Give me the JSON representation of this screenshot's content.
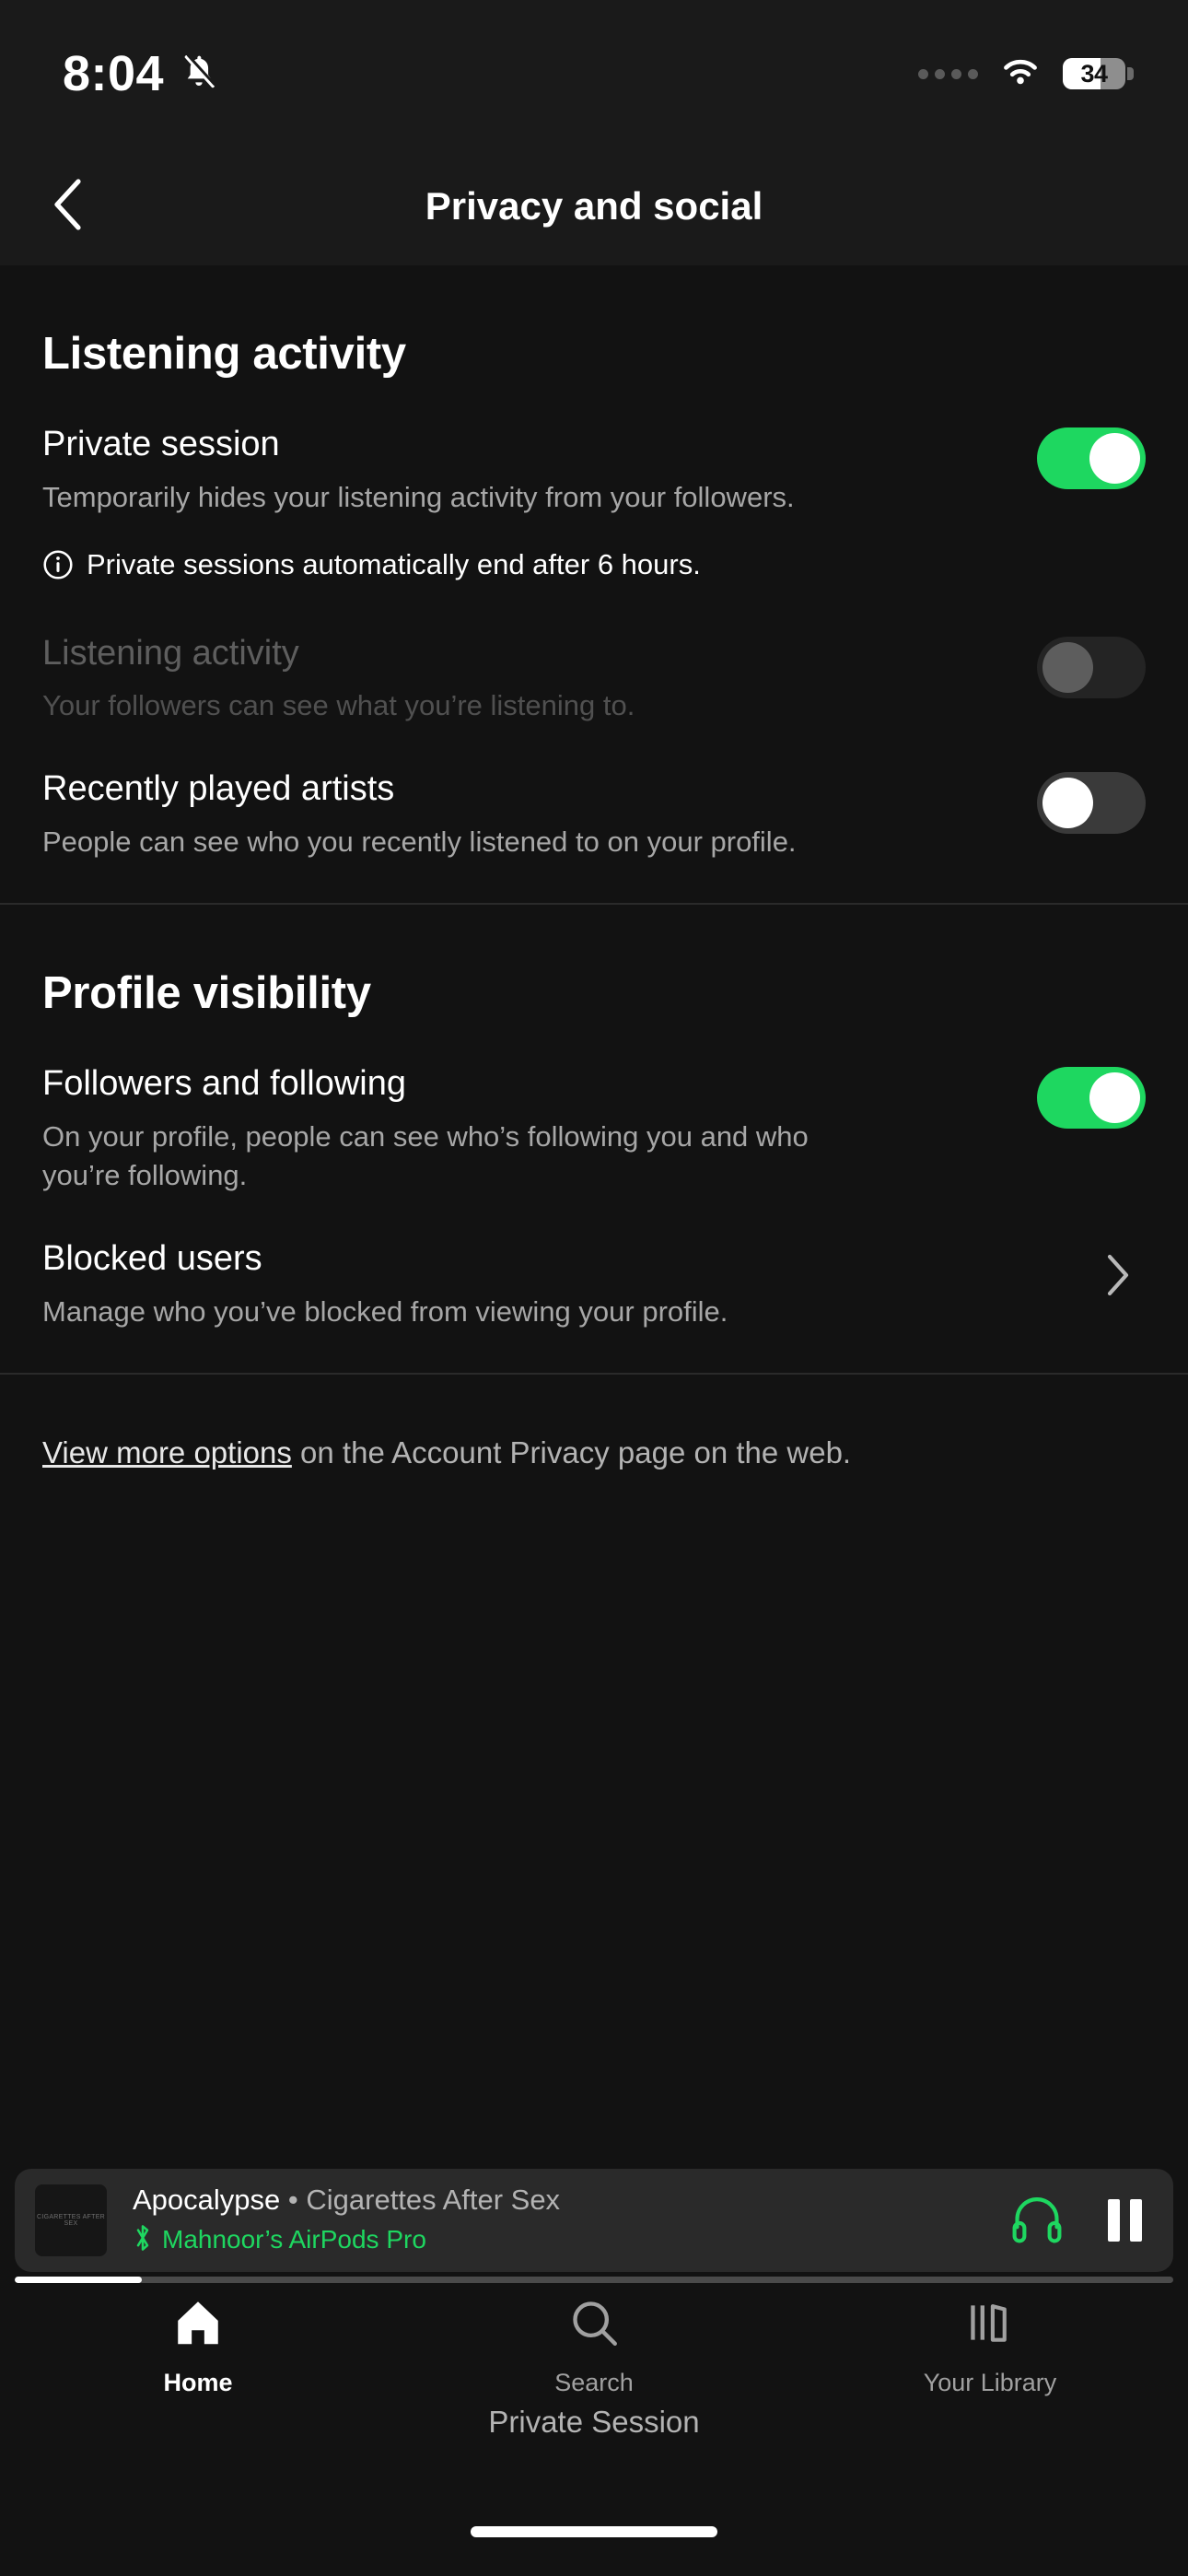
{
  "status_bar": {
    "time": "8:04",
    "mute_icon": "bell-slash-icon",
    "cellular_icon": "cellular-dots-icon",
    "wifi_icon": "wifi-icon",
    "battery_percent": "34",
    "battery_fill_ratio": 0.6
  },
  "nav": {
    "back_icon": "chevron-left-icon",
    "title": "Privacy and social"
  },
  "sections": [
    {
      "title": "Listening activity",
      "rows": [
        {
          "name": "private-session",
          "title": "Private session",
          "subtitle": "Temporarily hides your listening activity from your followers.",
          "control": "toggle",
          "state": "on",
          "disabled": false
        },
        {
          "name": "listening-activity",
          "title": "Listening activity",
          "subtitle": "Your followers can see what you’re listening to.",
          "control": "toggle",
          "state": "dim",
          "disabled": true
        },
        {
          "name": "recently-played-artists",
          "title": "Recently played artists",
          "subtitle": "People can see who you recently listened to on your profile.",
          "control": "toggle",
          "state": "off",
          "disabled": false
        }
      ]
    },
    {
      "title": "Profile visibility",
      "rows": [
        {
          "name": "followers-and-following",
          "title": "Followers and following",
          "subtitle": "On your profile, people can see who’s following you and who you’re following.",
          "control": "toggle",
          "state": "on",
          "disabled": false
        },
        {
          "name": "blocked-users",
          "title": "Blocked users",
          "subtitle": "Manage who you’ve blocked from viewing your profile.",
          "control": "chevron",
          "state": "",
          "disabled": false
        }
      ]
    }
  ],
  "note": {
    "icon": "info-circle-icon",
    "text": "Private sessions automatically end after 6 hours."
  },
  "footnote": {
    "link_text": "View more options",
    "rest_text": " on the Account Privacy page on the web."
  },
  "now_playing": {
    "album_art_text": "CIGARETTES AFTER SEX",
    "track": "Apocalypse",
    "separator": " • ",
    "artist": "Cigarettes After Sex",
    "bluetooth_icon": "bluetooth-icon",
    "device": "Mahnoor’s AirPods Pro",
    "headphones_icon": "headphones-icon",
    "pause_icon": "pause-icon",
    "progress_percent": 11
  },
  "tabs": [
    {
      "name": "home",
      "label": "Home",
      "icon": "home-icon",
      "active": true
    },
    {
      "name": "search",
      "label": "Search",
      "icon": "search-icon",
      "active": false
    },
    {
      "name": "your-library",
      "label": "Your Library",
      "icon": "library-icon",
      "active": false
    }
  ],
  "private_session_banner": "Private Session",
  "colors": {
    "accent_green": "#1ed760",
    "background": "#121212",
    "surface": "#1a1a1a",
    "now_playing_bg": "#2a2a2a",
    "text_primary": "#ffffff",
    "text_secondary": "#a7a7a7"
  }
}
